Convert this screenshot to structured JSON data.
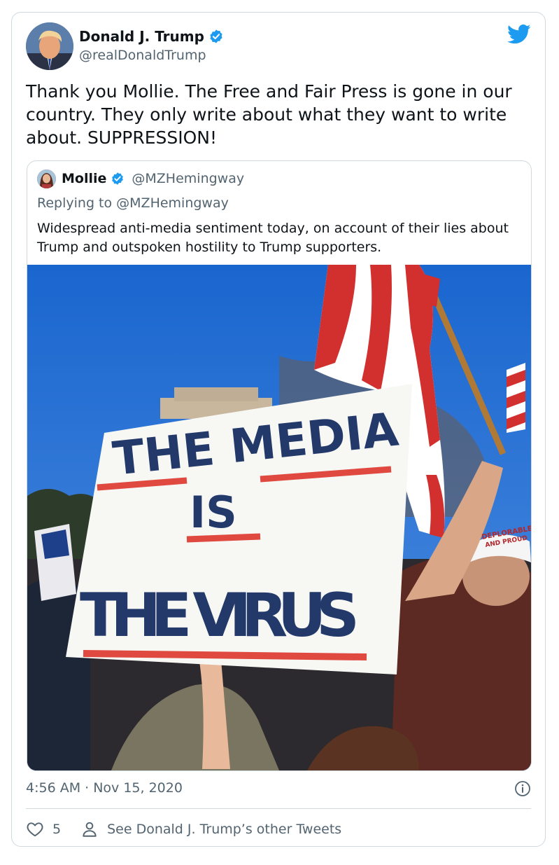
{
  "tweet": {
    "author": {
      "display_name": "Donald J. Trump",
      "handle": "@realDonaldTrump",
      "avatar": "avatar-photo",
      "verified_icon": "verified-badge-icon"
    },
    "brand_icon": "twitter-bird-icon",
    "text": "Thank you Mollie. The Free and Fair Press is gone in our country. They only write about what they want to write about. SUPPRESSION!",
    "timestamp": "4:56 AM · Nov 15, 2020",
    "info_icon": "info-icon",
    "actions": {
      "like_icon": "heart-icon",
      "like_count": "5",
      "profile_icon": "person-icon",
      "see_other_label": "See Donald J. Trump’s other Tweets"
    }
  },
  "quoted_tweet": {
    "author": {
      "display_name": "Mollie",
      "handle": "@MZHemingway",
      "verified_icon": "verified-badge-icon"
    },
    "replying_to": "Replying to @MZHemingway",
    "text": "Widespread anti-media sentiment today, on account of their lies about Trump and outspoken hostility to Trump supporters.",
    "photo": {
      "sign_lines": [
        "THE MEDIA",
        "IS",
        "THE VIRUS"
      ],
      "hat_text": [
        "DEPLORABLE",
        "AND PROUD"
      ]
    }
  },
  "colors": {
    "accent": "#1d9bf0",
    "text_primary": "#0f1419",
    "text_secondary": "#536471",
    "border": "#cfd9de",
    "sky": "#1f6fd1",
    "sign_red": "#e0493f",
    "sign_blue": "#22396a"
  }
}
